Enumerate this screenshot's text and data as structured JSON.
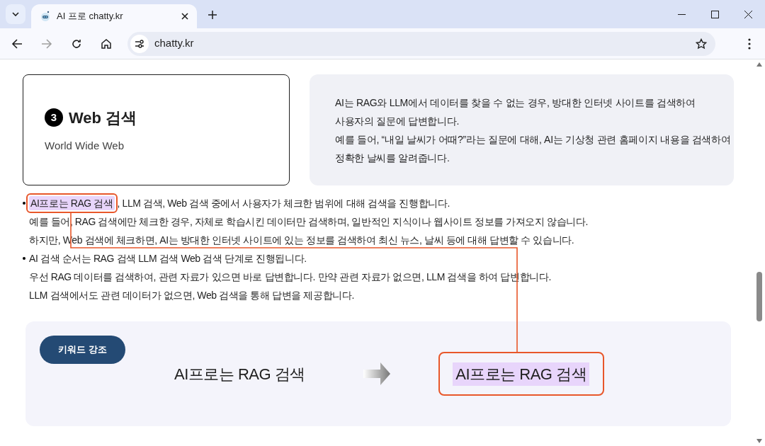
{
  "browser": {
    "tab": {
      "title": "AI 프로 chatty.kr"
    },
    "address": "chatty.kr"
  },
  "card": {
    "number": "3",
    "title": "Web 검색",
    "subtitle": "World Wide Web"
  },
  "description": [
    "AI는 RAG와 LLM에서 데이터를 찾을 수 없는 경우, 방대한 인터넷 사이트를 검색하여",
    "사용자의 질문에 답변합니다.",
    "예를 들어, “내일 날씨가 어때?”라는 질문에 대해, AI는 기상청 관련 홈페이지 내용을 검색하여",
    "정확한 날씨를 알려줍니다."
  ],
  "bullets": [
    {
      "highlight": "AI프로는 RAG 검색",
      "lines": [
        ", LLM 검색, Web 검색 중에서 사용자가 체크한 범위에 대해 검색을 진행합니다.",
        "예를 들어, RAG 검색에만 체크한 경우, 자체로 학습시킨 데이터만 검색하며, 일반적인 지식이나 웹사이트 정보를 가져오지 않습니다.",
        "하지만, Web 검색에 체크하면, AI는 방대한 인터넷 사이트에 있는 정보를 검색하여 최신 뉴스, 날씨 등에 대해 답변할 수 있습니다."
      ]
    },
    {
      "lines": [
        "AI 검색 순서는 RAG 검색 LLM 검색 Web 검색 단계로 진행됩니다.",
        "우선 RAG 데이터를 검색하여, 관련 자료가 있으면 바로 답변합니다. 만약 관련 자료가 없으면, LLM 검색을 하여 답변합니다.",
        "LLM 검색에서도 관련 데이터가 없으면, Web 검색을 통해 답변을 제공합니다."
      ]
    }
  ],
  "example": {
    "badge": "키워드 강조",
    "before": "AI프로는 RAG 검색",
    "after": "AI프로는 RAG 검색"
  }
}
